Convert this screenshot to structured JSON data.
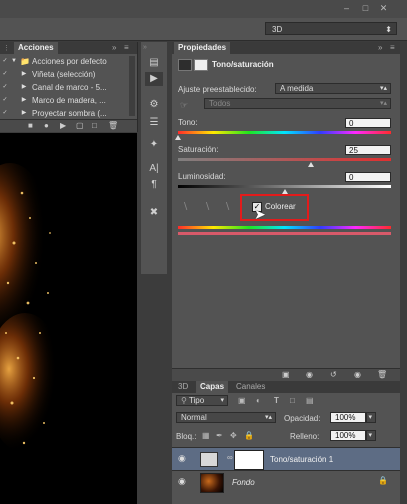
{
  "workspace": {
    "selector_value": "3D",
    "arrow": "⬍"
  },
  "actions_panel": {
    "tab_label": "Acciones",
    "items": [
      {
        "label": "Acciones por defecto",
        "expanded": true
      },
      {
        "label": "Viñeta (selección)"
      },
      {
        "label": "Canal de marco - 5..."
      },
      {
        "label": "Marco de madera, ..."
      },
      {
        "label": "Proyectar sombra (..."
      }
    ]
  },
  "properties": {
    "tab_label": "Propiedades",
    "title": "Tono/saturación",
    "preset_label": "Ajuste preestablecido:",
    "preset_value": "A medida",
    "channel_value": "Todos",
    "hue_label": "Tono:",
    "hue_value": "0",
    "hue_level": 0.0,
    "saturation_label": "Saturación:",
    "saturation_value": "25",
    "saturation_level": 0.625,
    "lightness_label": "Luminosidad:",
    "lightness_value": "0",
    "lightness_level": 0.5,
    "colorize_label": "Colorear",
    "colorize_checked": true,
    "highlight_color": "#e31b1b"
  },
  "layers_panel": {
    "tabs": [
      "3D",
      "Capas",
      "Canales"
    ],
    "active_tab": "Capas",
    "filter_label": "Tipo",
    "blend_mode": "Normal",
    "opacity_label": "Opacidad:",
    "opacity_value": "100%",
    "lock_label": "Bloq.:",
    "fill_label": "Relleno:",
    "fill_value": "100%",
    "layers": [
      {
        "name": "Tono/saturación 1",
        "selected": true
      },
      {
        "name": "Fondo",
        "italic": true,
        "locked": true
      }
    ]
  }
}
